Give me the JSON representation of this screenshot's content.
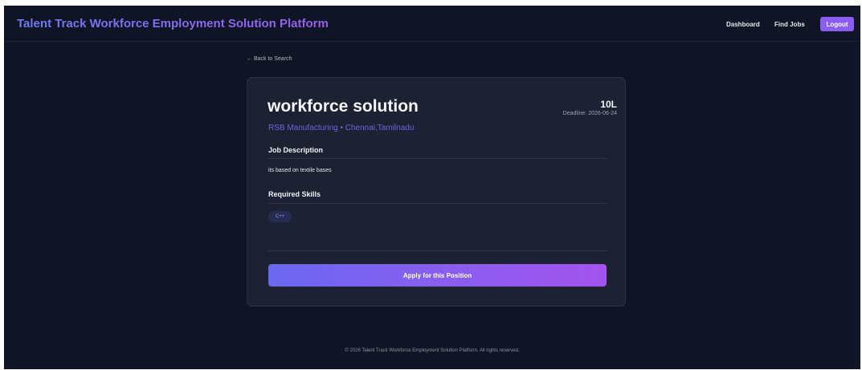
{
  "nav": {
    "brand": "Talent Track Workforce Employment Solution Platform",
    "dashboard": "Dashboard",
    "find_jobs": "Find Jobs",
    "logout": "Logout"
  },
  "back_link": "← Back to Search",
  "job": {
    "title": "workforce solution",
    "company_location": "RSB Manufacturing • Chennai,Tamilnadu",
    "salary": "10L",
    "deadline": "Deadline: 2026-06-24",
    "description_heading": "Job Description",
    "description": "its based on textile bases",
    "skills_heading": "Required Skills",
    "skills": [
      "C++"
    ],
    "apply_label": "Apply for this Position"
  },
  "footer": "© 2026 Talent Track Workforce Employment Solution Platform. All rights reserved.",
  "colors": {
    "background": "#0f1524",
    "card": "#1c2232",
    "accent": "#8b5cf6",
    "accent_blue": "#6b68f0"
  }
}
